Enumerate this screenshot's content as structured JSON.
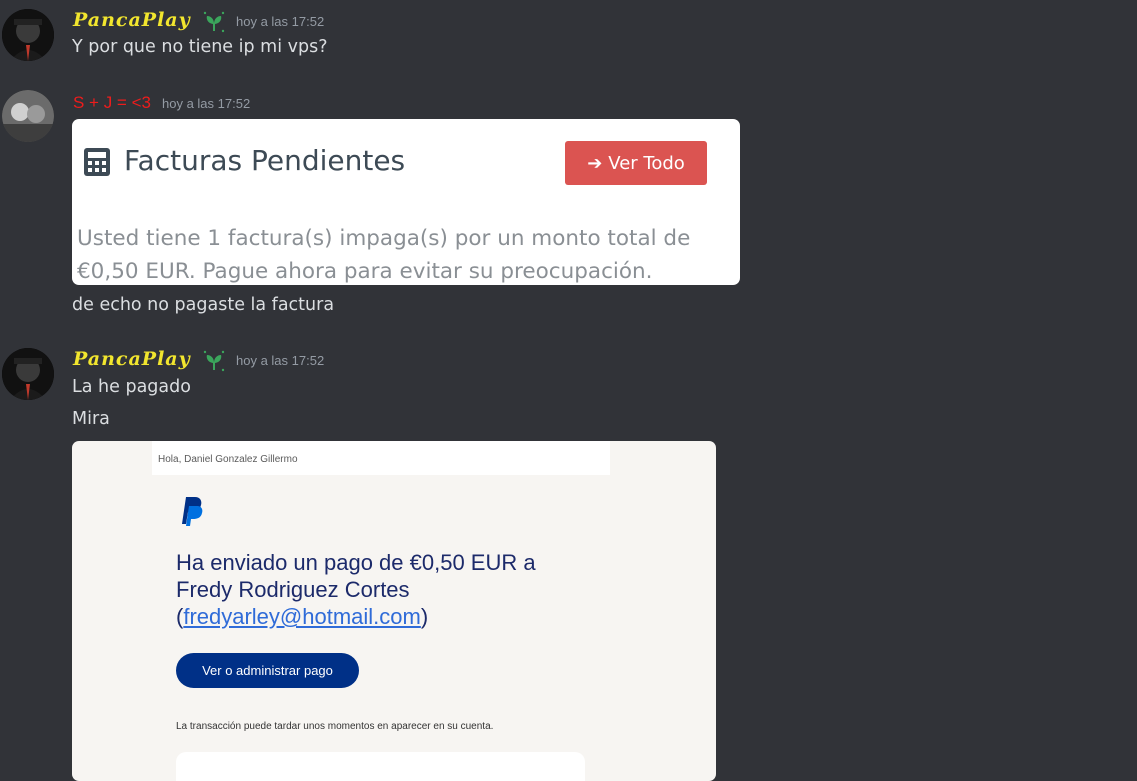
{
  "messages": [
    {
      "author": "PancaPlay",
      "timestamp": "hoy a las 17:52",
      "text": "Y por que no tiene ip mi vps?"
    },
    {
      "author": "S + J = <3",
      "timestamp": "hoy a las 17:52",
      "text": "de echo no pagaste la factura",
      "embed": {
        "title": "Facturas Pendientes",
        "button_label": "Ver Todo",
        "body": "Usted tiene 1 factura(s) impaga(s) por un monto total de €0,50 EUR. Pague ahora para evitar su preocupación."
      }
    },
    {
      "author": "PancaPlay",
      "timestamp": "hoy a las 17:52",
      "lines": [
        "La he pagado",
        "Mira"
      ],
      "embed": {
        "greeting": "Hola, Daniel Gonzalez Gillermo",
        "heading_prefix": "Ha enviado un pago de €0,50 EUR a Fredy Rodriguez Cortes (",
        "email": "fredyarley@hotmail.com",
        "heading_suffix": ")",
        "button_label": "Ver o administrar pago",
        "note": "La transacción puede tardar unos momentos en aparecer en su cuenta."
      }
    }
  ],
  "colors": {
    "background": "#313338",
    "name_gold": "#f2e62e",
    "name_red": "#ed1c1c",
    "timestamp": "#949ba4",
    "text": "#dbdee1",
    "invoice_button": "#db5451",
    "paypal_button": "#003087"
  },
  "icons": {
    "badge": "sprout-icon",
    "invoice": "calculator-icon",
    "invoice_button": "arrow-right-icon",
    "paypal": "paypal-logo"
  }
}
